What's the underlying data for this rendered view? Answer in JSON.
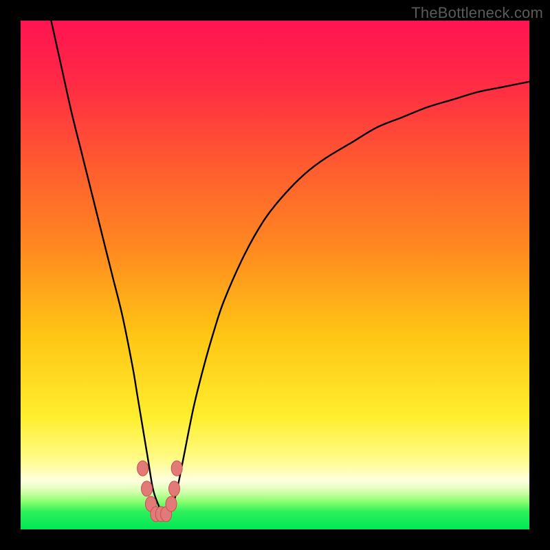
{
  "watermark": "TheBottleneck.com",
  "colors": {
    "frame": "#000000",
    "curve": "#000000",
    "marker_fill": "#e27a7a",
    "marker_stroke": "#c94f4f",
    "green_band": "#00e756",
    "gradient_stops": [
      {
        "offset": 0.0,
        "color": "#ff1452"
      },
      {
        "offset": 0.12,
        "color": "#ff2a45"
      },
      {
        "offset": 0.28,
        "color": "#ff5a30"
      },
      {
        "offset": 0.45,
        "color": "#ff8a20"
      },
      {
        "offset": 0.62,
        "color": "#ffc615"
      },
      {
        "offset": 0.78,
        "color": "#ffee2e"
      },
      {
        "offset": 0.86,
        "color": "#fffb86"
      },
      {
        "offset": 0.905,
        "color": "#ffffe0"
      },
      {
        "offset": 0.925,
        "color": "#d6ffb0"
      },
      {
        "offset": 0.945,
        "color": "#8cff70"
      },
      {
        "offset": 0.965,
        "color": "#2df05b"
      },
      {
        "offset": 1.0,
        "color": "#00e756"
      }
    ]
  },
  "chart_data": {
    "type": "line",
    "title": "",
    "xlabel": "",
    "ylabel": "",
    "xlim": [
      0,
      100
    ],
    "ylim": [
      0,
      100
    ],
    "grid": false,
    "legend": false,
    "series": [
      {
        "name": "bottleneck-curve",
        "x": [
          6,
          8,
          10,
          12,
          14,
          16,
          18,
          20,
          22,
          23,
          24,
          25,
          26,
          27,
          28,
          29,
          30,
          31,
          32,
          34,
          36,
          38,
          40,
          44,
          48,
          52,
          56,
          60,
          65,
          70,
          75,
          80,
          85,
          90,
          95,
          100
        ],
        "y": [
          100,
          91,
          82,
          74,
          66,
          58,
          50,
          42,
          32,
          26,
          20,
          14,
          8,
          5,
          3,
          3,
          5,
          9,
          14,
          24,
          32,
          39,
          45,
          54,
          61,
          66,
          70,
          73,
          76,
          79,
          81,
          83,
          84.5,
          86,
          87,
          88
        ]
      }
    ],
    "markers": [
      {
        "x": 24.0,
        "y": 12
      },
      {
        "x": 24.8,
        "y": 8
      },
      {
        "x": 25.6,
        "y": 5
      },
      {
        "x": 26.6,
        "y": 3
      },
      {
        "x": 27.6,
        "y": 3
      },
      {
        "x": 28.6,
        "y": 3
      },
      {
        "x": 29.6,
        "y": 5
      },
      {
        "x": 30.2,
        "y": 8
      },
      {
        "x": 30.7,
        "y": 12
      }
    ]
  }
}
